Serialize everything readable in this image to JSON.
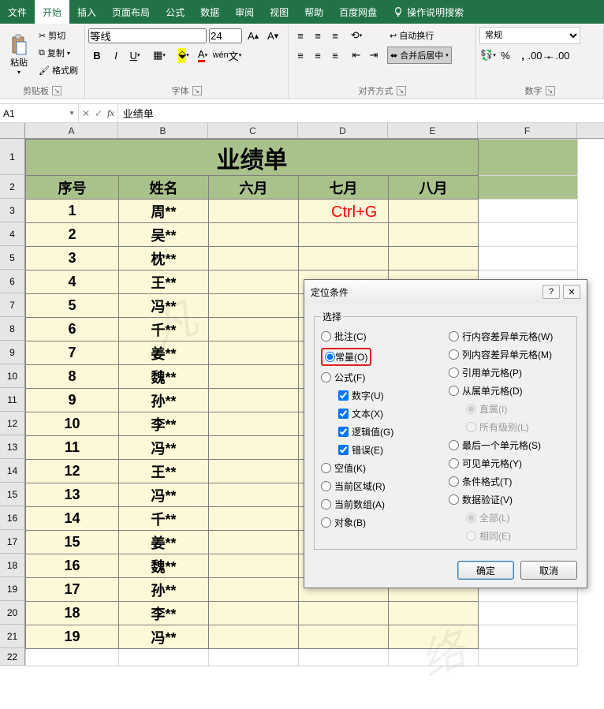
{
  "tabs": {
    "file": "文件",
    "home": "开始",
    "insert": "插入",
    "layout": "页面布局",
    "formulas": "公式",
    "data": "数据",
    "review": "审阅",
    "view": "视图",
    "help": "帮助",
    "baidu": "百度网盘",
    "tellme": "操作说明搜索"
  },
  "ribbon": {
    "clipboard": {
      "paste": "粘贴",
      "cut": "剪切",
      "copy": "复制",
      "format_painter": "格式刷",
      "group": "剪贴板"
    },
    "font": {
      "name": "等线",
      "size": "24",
      "group": "字体"
    },
    "alignment": {
      "wrap": "自动换行",
      "merge": "合并后居中",
      "group": "对齐方式"
    },
    "number": {
      "format": "常规",
      "group": "数字"
    }
  },
  "namebox": "A1",
  "formula_bar": "业绩单",
  "columns": [
    "A",
    "B",
    "C",
    "D",
    "E",
    "F"
  ],
  "row_numbers": [
    "1",
    "2",
    "3",
    "4",
    "5",
    "6",
    "7",
    "8",
    "9",
    "10",
    "11",
    "12",
    "13",
    "14",
    "15",
    "16",
    "17",
    "18",
    "19",
    "20",
    "21",
    "22"
  ],
  "sheet": {
    "title": "业绩单",
    "headers": [
      "序号",
      "姓名",
      "六月",
      "七月",
      "八月"
    ],
    "rows": [
      {
        "n": "1",
        "name": "周**"
      },
      {
        "n": "2",
        "name": "吴**"
      },
      {
        "n": "3",
        "name": "枕**"
      },
      {
        "n": "4",
        "name": "王**"
      },
      {
        "n": "5",
        "name": "冯**"
      },
      {
        "n": "6",
        "name": "千**"
      },
      {
        "n": "7",
        "name": "姜**"
      },
      {
        "n": "8",
        "name": "魏**"
      },
      {
        "n": "9",
        "name": "孙**"
      },
      {
        "n": "10",
        "name": "李**"
      },
      {
        "n": "11",
        "name": "冯**"
      },
      {
        "n": "12",
        "name": "王**"
      },
      {
        "n": "13",
        "name": "冯**"
      },
      {
        "n": "14",
        "name": "千**"
      },
      {
        "n": "15",
        "name": "姜**"
      },
      {
        "n": "16",
        "name": "魏**"
      },
      {
        "n": "17",
        "name": "孙**"
      },
      {
        "n": "18",
        "name": "李**"
      },
      {
        "n": "19",
        "name": "冯**"
      }
    ]
  },
  "overlay_shortcut": "Ctrl+G",
  "dialog": {
    "title": "定位条件",
    "group_label": "选择",
    "left": {
      "comments": "批注(C)",
      "constants": "常量(O)",
      "formulas": "公式(F)",
      "numbers": "数字(U)",
      "text": "文本(X)",
      "logicals": "逻辑值(G)",
      "errors": "错误(E)",
      "blanks": "空值(K)",
      "current_region": "当前区域(R)",
      "current_array": "当前数组(A)",
      "objects": "对象(B)"
    },
    "right": {
      "row_diff": "行内容差异单元格(W)",
      "col_diff": "列内容差异单元格(M)",
      "precedents": "引用单元格(P)",
      "dependents": "从属单元格(D)",
      "direct": "直属(I)",
      "all_levels": "所有级别(L)",
      "last_cell": "最后一个单元格(S)",
      "visible": "可见单元格(Y)",
      "cond_fmt": "条件格式(T)",
      "data_val": "数据验证(V)",
      "all": "全部(L)",
      "same": "相同(E)"
    },
    "ok": "确定",
    "cancel": "取消"
  }
}
